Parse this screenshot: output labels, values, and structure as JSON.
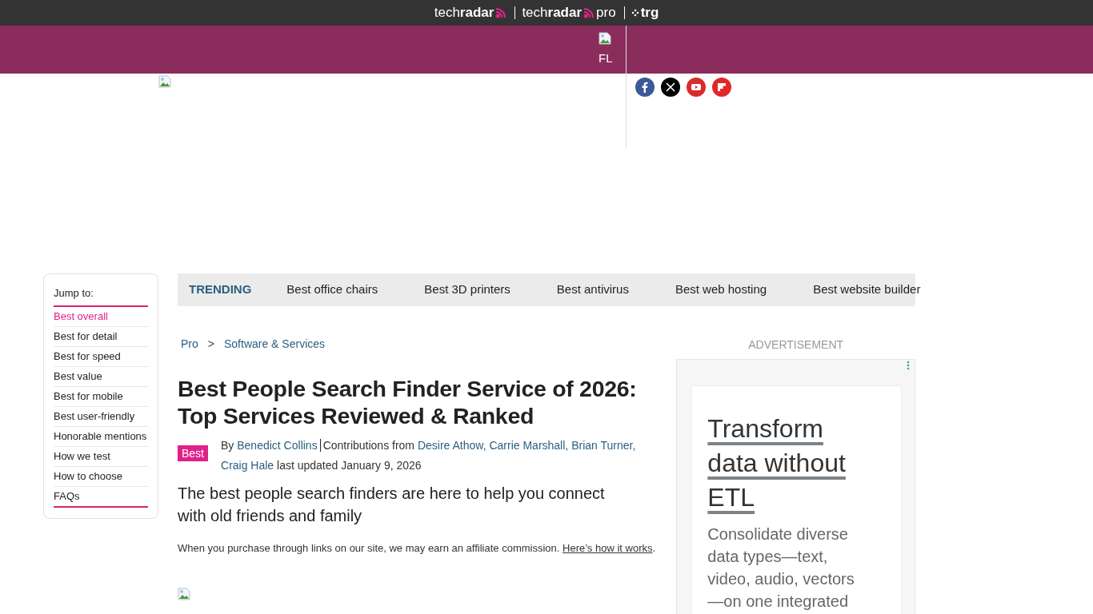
{
  "brand_bar": {
    "brands": [
      {
        "kind": "radar",
        "text": "tech**radar**"
      },
      {
        "kind": "radar",
        "text": "tech**radar**",
        "suffix": "pro"
      },
      {
        "kind": "trg",
        "text": "trg"
      }
    ]
  },
  "banner": {
    "caption": "FL"
  },
  "jump_to": {
    "title": "Jump to:",
    "items": [
      {
        "label": "Best overall",
        "selected": true
      },
      {
        "label": "Best for detail",
        "selected": false
      },
      {
        "label": "Best for speed",
        "selected": false
      },
      {
        "label": "Best value",
        "selected": false
      },
      {
        "label": "Best for mobile",
        "selected": false
      },
      {
        "label": "Best user-friendly",
        "selected": false
      },
      {
        "label": "Honorable mentions",
        "selected": false
      },
      {
        "label": "How we test",
        "selected": false
      },
      {
        "label": "How to choose",
        "selected": false
      },
      {
        "label": "FAQs",
        "selected": false
      }
    ]
  },
  "trending": {
    "label": "TRENDING",
    "items": [
      "Best office chairs",
      "Best 3D printers",
      "Best antivirus",
      "Best web hosting",
      "Best website builder"
    ]
  },
  "breadcrumb": [
    "Pro",
    "Software & Services"
  ],
  "breadcrumb_separator": ">",
  "article": {
    "title": "Best People Search Finder Service of 2026: Top Services Reviewed & Ranked",
    "badge": "Best",
    "by": "By",
    "author": "Benedict Collins",
    "contrib_label": "Contributions from",
    "contributors": [
      "Desire Athow,",
      "Carrie Marshall,",
      "Brian Turner,",
      "Craig Hale"
    ],
    "updated": "last updated January 9, 2026",
    "strapline": "The best people search finders are here to help you connect with old friends and family",
    "disclaimer": "When you purchase through links on our site, we may earn an affiliate commission.",
    "disclaimer_link": "Here’s how it works",
    "disclaimer_end": "."
  },
  "ad": {
    "label": "ADVERTISEMENT",
    "headline": "Transform data without ETL",
    "body": "Consolidate diverse data types—text, video, audio, vectors —on one integrated"
  }
}
